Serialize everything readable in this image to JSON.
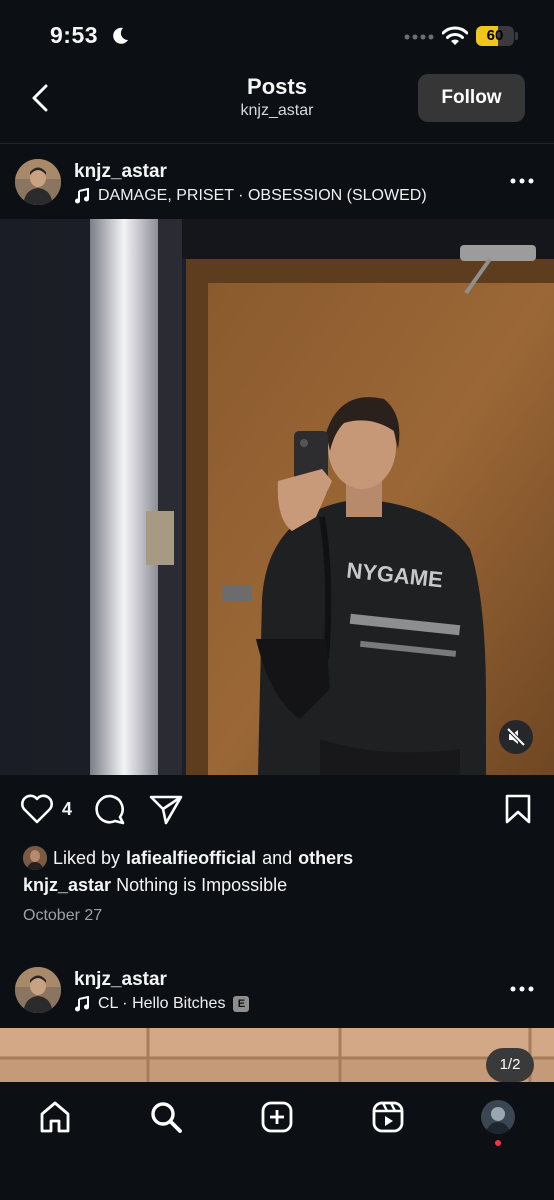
{
  "status_bar": {
    "time": "9:53",
    "battery": "60",
    "icons": [
      "moon-icon",
      "signal-dots-icon",
      "wifi-icon",
      "battery-icon"
    ]
  },
  "header": {
    "title": "Posts",
    "subtitle": "knjz_astar",
    "follow_label": "Follow"
  },
  "posts": [
    {
      "username": "knjz_astar",
      "music": "DAMAGE, PRISET · OBSESSION (SLOWED)",
      "like_count": "4",
      "liked_by_prefix": "Liked by",
      "liked_by_user": "lafiealfieofficial",
      "liked_by_and": "and",
      "liked_by_others": "others",
      "caption_user": "knjz_astar",
      "caption_text": "Nothing is Impossible",
      "date": "October 27"
    },
    {
      "username": "knjz_astar",
      "music": "CL · Hello Bitches",
      "explicit": "E",
      "pager": "1/2"
    }
  ],
  "nav": {
    "items": [
      "home-icon",
      "search-icon",
      "create-icon",
      "reels-icon",
      "profile-avatar"
    ]
  },
  "colors": {
    "background": "#0c1014",
    "button": "#363636",
    "battery": "#f2c617",
    "notification_dot": "#ff3040"
  }
}
